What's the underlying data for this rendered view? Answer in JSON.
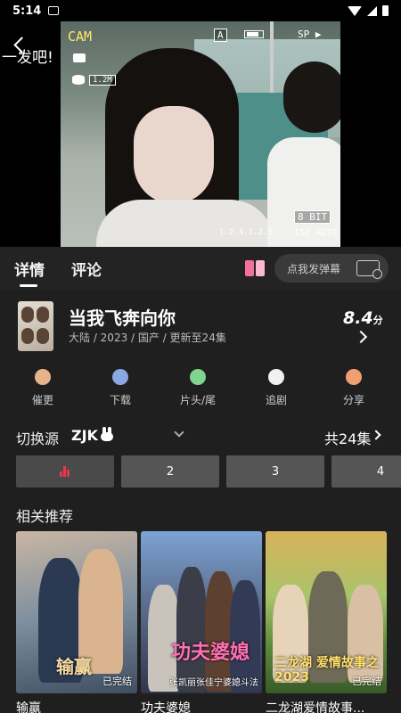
{
  "status_bar": {
    "time": "5:14"
  },
  "video": {
    "title": "一发吧!",
    "overlay": {
      "cam": "CAM",
      "mode": "A",
      "sp": "SP ▶",
      "size": "1.2M",
      "bit": "8 BIT",
      "version": "1.2.4.1.2.3",
      "iso": "ISO AUTO"
    }
  },
  "tabs": [
    {
      "label": "详情",
      "active": true
    },
    {
      "label": "评论",
      "active": false
    }
  ],
  "danmaku": {
    "placeholder": "点我发弹幕"
  },
  "show": {
    "title": "当我飞奔向你",
    "meta": "大陆 / 2023 / 国产 / 更新至24集",
    "score": "8.4",
    "score_unit": "分"
  },
  "actions": [
    {
      "label": "催更",
      "icon": "urge-icon",
      "color": "#e7b48a"
    },
    {
      "label": "下载",
      "icon": "download-icon",
      "color": "#8aa7e0"
    },
    {
      "label": "片头/尾",
      "icon": "skip-icon",
      "color": "#7fd48f"
    },
    {
      "label": "追剧",
      "icon": "follow-icon",
      "color": "#f1f1f1"
    },
    {
      "label": "分享",
      "icon": "share-icon",
      "color": "#f0a070"
    }
  ],
  "source": {
    "label": "切换源",
    "value": "ZJK",
    "episode_count": "共24集"
  },
  "episodes": [
    "",
    "2",
    "3",
    "4"
  ],
  "related": {
    "title": "相关推荐",
    "items": [
      {
        "caption": "输赢",
        "badge": "已完结",
        "poster_text": "输赢",
        "color": "#5f7488"
      },
      {
        "caption": "功夫婆媳",
        "badge": "张凯丽张佳宁婆媳斗法",
        "poster_text": "功夫婆媳",
        "color": "#6a6f80"
      },
      {
        "caption": "二龙湖爱情故事...",
        "badge": "已完结",
        "poster_text": "二龙湖 爱情故事之2023",
        "color": "#7d7c3d"
      }
    ]
  }
}
